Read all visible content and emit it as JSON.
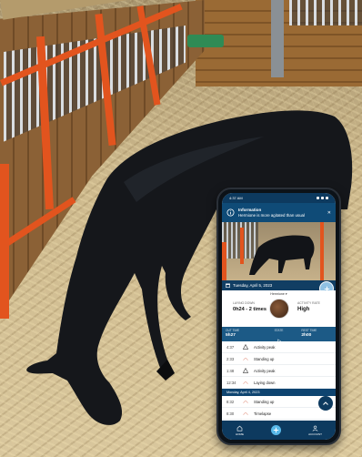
{
  "app": {
    "status_bar": {
      "time": "4:37 AM"
    },
    "notification": {
      "title": "Information",
      "message": "Hermione is more agitated than usual"
    },
    "date_bar": {
      "date": "Tuesday, April 5, 2023"
    },
    "horse": {
      "name": "Hermione",
      "laying_down_label": "LAYING DOWN",
      "laying_down_value": "0h24 - 2 times",
      "activity_rate_label": "ACTIVITY RATE",
      "activity_rate_value": "High"
    },
    "stats": {
      "out_time_label": "OUT TIME",
      "out_time_value": "5h27",
      "state_label": "STATE",
      "rest_time_label": "REST TIME",
      "rest_time_value": "2h00"
    },
    "events_today": [
      {
        "time": "4:37",
        "label": "Activity peak",
        "icon": "warning-triangle-icon"
      },
      {
        "time": "2:33",
        "label": "Standing up",
        "icon": "curve-icon"
      },
      {
        "time": "1:48",
        "label": "Activity peak",
        "icon": "warning-triangle-icon"
      },
      {
        "time": "12:34",
        "label": "Laying down",
        "icon": "curve-icon"
      }
    ],
    "section_previous": "Monday, April 4, 2023",
    "events_previous": [
      {
        "time": "8:32",
        "label": "Standing up",
        "icon": "curve-icon"
      },
      {
        "time": "8:30",
        "label": "Timelapse",
        "icon": "curve-icon"
      }
    ],
    "tabs": {
      "home": "HOME",
      "account": "ACCOUNT"
    },
    "colors": {
      "primary": "#0d3a5f",
      "accent": "#58b8e8",
      "stall_orange": "#e2541e"
    }
  }
}
